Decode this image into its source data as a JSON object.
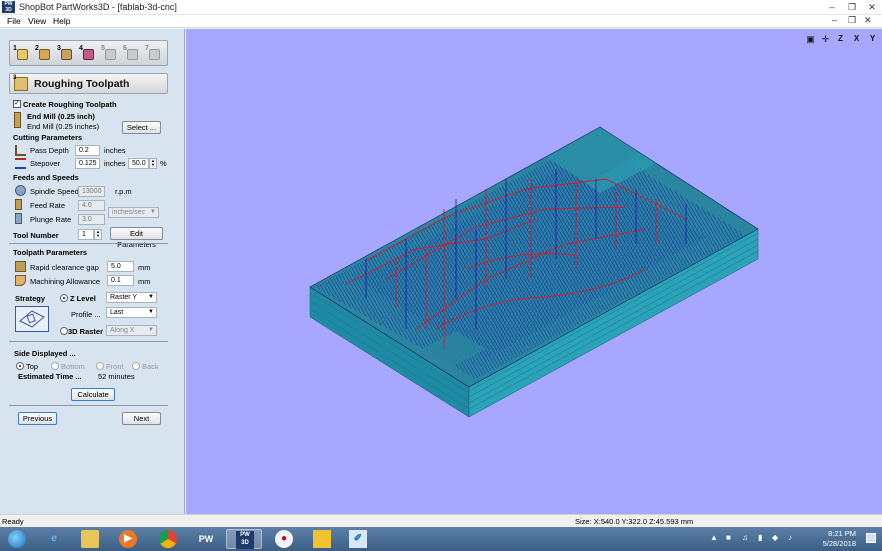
{
  "window": {
    "title": "ShopBot PartWorks3D - [fablab-3d-cnc]",
    "app_icon_label": "PW 3D",
    "controls": [
      "minimize-icon",
      "maximize-icon",
      "close-icon"
    ]
  },
  "menu": {
    "items": [
      "File",
      "View",
      "Help"
    ]
  },
  "panel": {
    "tabs": [
      "1",
      "2",
      "3",
      "4",
      "5",
      "6",
      "7"
    ],
    "heading_number": "3",
    "heading": "Roughing Toolpath",
    "create_checkbox_label": "Create Roughing Toolpath",
    "create_checked": true,
    "tool_name": "End Mill (0.25 inch)",
    "tool_sub": "End Mill (0.25 inches)",
    "select_button": "Select ...",
    "cutting_params": {
      "heading": "Cutting Parameters",
      "pass_depth_label": "Pass Depth",
      "pass_depth_value": "0.2",
      "pass_depth_unit": "inches",
      "stepover_label": "Stepover",
      "stepover_value": "0.125",
      "stepover_unit": "inches",
      "stepover_percent": "50.0",
      "percent_sign": "%"
    },
    "feeds": {
      "heading": "Feeds and Speeds",
      "spindle_label": "Spindle Speed",
      "spindle_value": "13000",
      "spindle_unit": "r.p.m",
      "feed_label": "Feed Rate",
      "feed_value": "4.0",
      "plunge_label": "Plunge Rate",
      "plunge_value": "3.0",
      "rate_unit": "inches/sec"
    },
    "tool_number": {
      "label": "Tool Number",
      "value": "1",
      "edit_button": "Edit Parameters"
    },
    "toolpath_params": {
      "heading": "Toolpath Parameters",
      "rapid_label": "Rapid clearance gap",
      "rapid_value": "5.0",
      "rapid_unit": "mm",
      "allowance_label": "Machining Allowance",
      "allowance_value": "0.1",
      "allowance_unit": "mm"
    },
    "strategy": {
      "label": "Strategy",
      "zlevel_label": "Z Level",
      "zlevel_selected": true,
      "zlevel_option": "Raster Y",
      "profile_label": "Profile ...",
      "profile_option": "Last",
      "raster_label": "3D Raster",
      "raster_option": "Along X"
    },
    "side": {
      "heading": "Side Displayed ...",
      "options": [
        "Top",
        "Bottom",
        "Front",
        "Back"
      ],
      "selected": "Top"
    },
    "estimate": {
      "label": "Estimated Time ...",
      "value": "52 minutes"
    },
    "calculate_button": "Calculate",
    "previous_button": "Previous",
    "next_button": "Next"
  },
  "viewport": {
    "background": "#a7a7ff",
    "tools": [
      "zoom-fit-icon",
      "view-iso-icon",
      "view-z-icon",
      "view-x-icon",
      "view-y-icon"
    ],
    "tool_labels": [
      "",
      "",
      "Z",
      "X",
      "Y"
    ],
    "colors": {
      "block_top": "#2a86a0",
      "block_side": "#1d7f95",
      "block_front": "#2a96ad",
      "toolpath_raster": "#1a1aa8",
      "toolpath_link": "#d81b2c"
    }
  },
  "status": {
    "left": "Ready",
    "size": "Size: X:540.0 Y:322.0 Z:45.593 mm"
  },
  "taskbar": {
    "apps": [
      "start-icon",
      "ie-icon",
      "explorer-icon",
      "media-player-icon",
      "chrome-icon",
      "pw-icon",
      "pw3d-icon",
      "paint-icon",
      "shopbot-icon",
      "paint-brush-icon"
    ],
    "app_labels": [
      "",
      "e",
      "",
      "",
      "",
      "PW",
      "PW 3D",
      "",
      "",
      ""
    ],
    "active": "pw3d-icon",
    "time": "8:21 PM",
    "date": "5/28/2018"
  }
}
